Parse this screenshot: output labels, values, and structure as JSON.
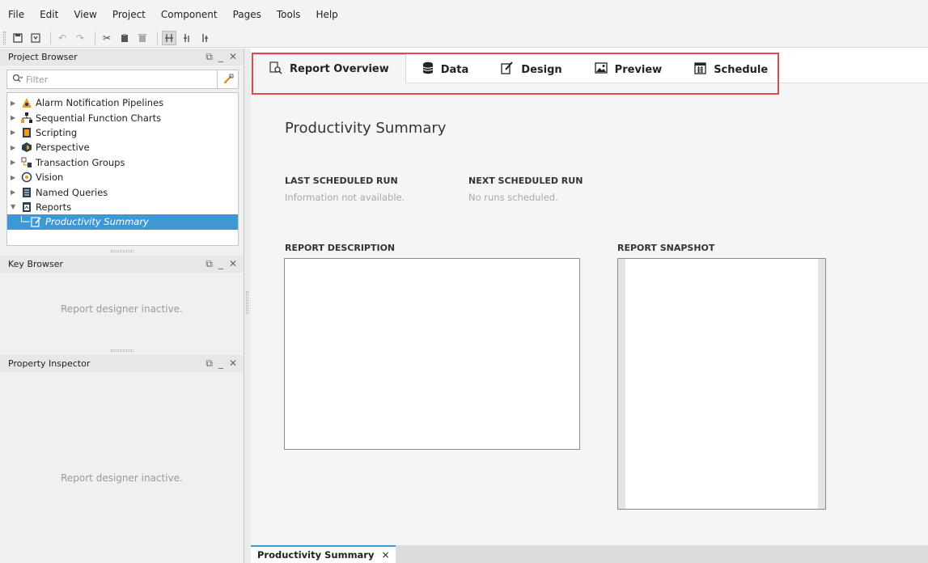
{
  "menu": [
    "File",
    "Edit",
    "View",
    "Project",
    "Component",
    "Pages",
    "Tools",
    "Help"
  ],
  "toolbar": {
    "buttons": [
      "save-icon",
      "save-all-icon",
      "undo-icon",
      "redo-icon",
      "cut-icon",
      "paste-icon",
      "delete-icon",
      "align-icon",
      "distribute-icon",
      "grid-icon"
    ]
  },
  "project_browser": {
    "title": "Project Browser",
    "filter_placeholder": "Filter",
    "tree": [
      {
        "label": "Alarm Notification Pipelines",
        "icon": "alarm-pipeline-icon"
      },
      {
        "label": "Sequential Function Charts",
        "icon": "sfc-icon"
      },
      {
        "label": "Scripting",
        "icon": "scripting-icon"
      },
      {
        "label": "Perspective",
        "icon": "perspective-icon"
      },
      {
        "label": "Transaction Groups",
        "icon": "transaction-groups-icon"
      },
      {
        "label": "Vision",
        "icon": "vision-icon"
      },
      {
        "label": "Named Queries",
        "icon": "named-queries-icon"
      },
      {
        "label": "Reports",
        "icon": "reports-icon"
      }
    ],
    "selected_item": "Productivity Summary"
  },
  "key_browser": {
    "title": "Key Browser",
    "message": "Report designer inactive."
  },
  "property_inspector": {
    "title": "Property Inspector",
    "message": "Report designer inactive."
  },
  "tabs": [
    {
      "label": "Report Overview",
      "icon": "report-overview-icon",
      "active": true
    },
    {
      "label": "Data",
      "icon": "database-icon",
      "active": false
    },
    {
      "label": "Design",
      "icon": "design-icon",
      "active": false
    },
    {
      "label": "Preview",
      "icon": "preview-icon",
      "active": false
    },
    {
      "label": "Schedule",
      "icon": "calendar-icon",
      "active": false
    }
  ],
  "overview": {
    "title": "Productivity Summary",
    "last_run_label": "LAST SCHEDULED RUN",
    "last_run_value": "Information not available.",
    "next_run_label": "NEXT SCHEDULED RUN",
    "next_run_value": "No runs scheduled.",
    "description_label": "REPORT DESCRIPTION",
    "snapshot_label": "REPORT SNAPSHOT"
  },
  "document_tab": {
    "label": "Productivity Summary",
    "close": "×"
  },
  "colors": {
    "selection": "#3d98d5",
    "highlight_box": "#e2474b",
    "muted_text": "#a8a8a8"
  }
}
